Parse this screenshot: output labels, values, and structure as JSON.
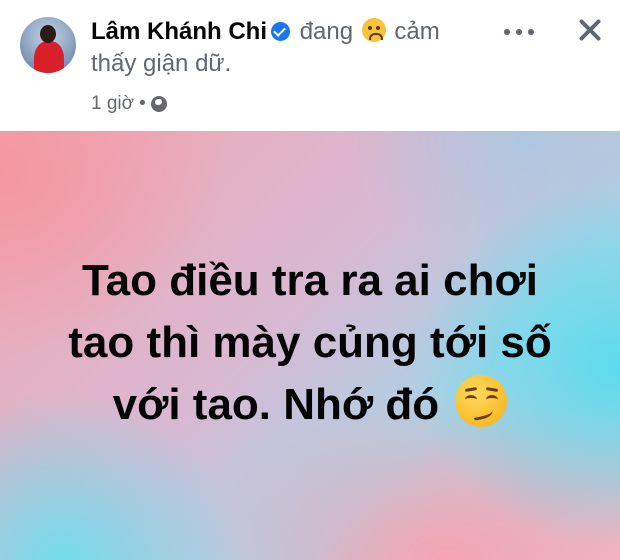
{
  "header": {
    "author_name": "Lâm Khánh Chi",
    "feeling_prefix": "đang",
    "feeling_icon": "angry-face-icon",
    "feeling_suffix": "cảm",
    "feeling_line2": "thấy giận dữ.",
    "timestamp": "1 giờ",
    "separator": "•",
    "privacy_icon": "globe-icon",
    "verified_color": "#1877f2"
  },
  "post": {
    "lines": [
      "Tao điều tra ra ai chơi",
      "tao thì mày củng tới số",
      "với tao. Nhớ đó"
    ],
    "emoji": "smirking-face-icon"
  }
}
